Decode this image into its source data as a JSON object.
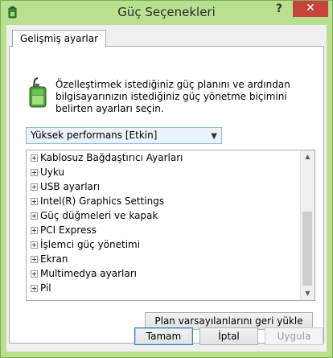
{
  "window": {
    "title": "Güç Seçenekleri",
    "help_label": "?",
    "close_label": "✕",
    "frame_color": "#b9e08f",
    "close_color": "#c7443a"
  },
  "tabs": [
    {
      "label": "Gelişmiş ayarlar",
      "selected": true
    }
  ],
  "panel": {
    "description": "Özelleştirmek istediğiniz güç planını ve ardından bilgisayarınızın istediğiniz güç yönetme biçimini belirten ayarları seçin.",
    "plan_select": {
      "value": "Yüksek performans [Etkin]"
    },
    "settings_tree": {
      "items": [
        {
          "label": "Kablosuz Bağdaştırıcı Ayarları"
        },
        {
          "label": "Uyku"
        },
        {
          "label": "USB ayarları"
        },
        {
          "label": "Intel(R) Graphics Settings"
        },
        {
          "label": "Güç düğmeleri ve kapak"
        },
        {
          "label": "PCI Express"
        },
        {
          "label": "İşlemci güç yönetimi"
        },
        {
          "label": "Ekran"
        },
        {
          "label": "Multimedya ayarları"
        },
        {
          "label": "Pil"
        }
      ]
    },
    "restore_button": "Plan varsayılanlarını geri yükle"
  },
  "footer": {
    "ok_label": "Tamam",
    "cancel_label": "İptal",
    "apply_label": "Uygula"
  },
  "icons": {
    "app": "power-options-icon",
    "battery": "battery-plug-icon"
  }
}
